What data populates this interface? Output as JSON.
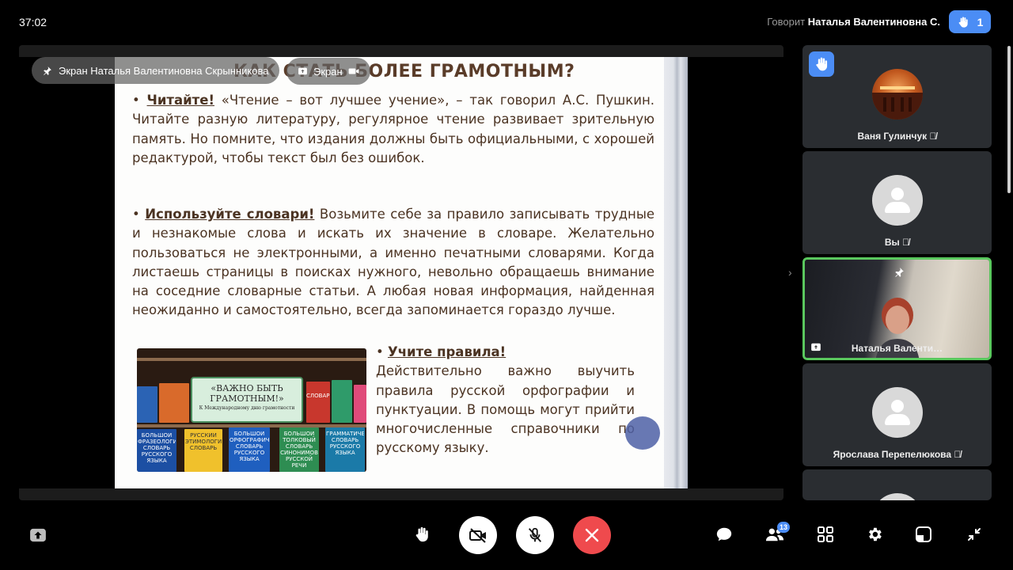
{
  "header": {
    "timer": "37:02",
    "speaking_label": "Говорит",
    "speaking_name": "Наталья Валентиновна С.",
    "raised_hands_count": "1"
  },
  "overlay": {
    "owner_chip": "Экран Наталья Валентиновна Скрынникова",
    "screen_chip": "Экран"
  },
  "slide": {
    "title": "КАК СТАТЬ БОЛЕЕ ГРАМОТНЫМ?",
    "p1_head": "Читайте!",
    "p1_body": " «Чтение – вот лучшее учение», – так говорил А.С. Пушкин. Читайте разную литературу, регулярное чтение развивает зрительную память. Но помните, что издания должны быть официальными, с хорошей редактурой, чтобы текст был без ошибок.",
    "p2_head": "Используйте словари!",
    "p2_body": " Возьмите себе за правило записывать трудные и незнакомые слова и искать их значение в словаре. Желательно пользоваться не электронными, а именно печатными словарями. Когда листаешь страницы в поисках нужного, невольно обращаешь внимание на соседние словарные статьи. А любая новая информация, найденная неожиданно и самостоятельно, всегда запоминается гораздо лучше.",
    "p3_head": "Учите правила!",
    "p3_body": "Действительно важно выучить правила русской орфографии и пунктуации. В помощь могут прийти многочисленные справочники по русскому языку.",
    "image": {
      "sign_text": "«ВАЖНО БЫТЬ ГРАМОТНЫМ!»",
      "sign_sub": "К Международному дню грамотности",
      "book1": "БОЛЬШОЙ ФРАЗЕОЛОГИЧЕСКИЙ СЛОВАРЬ РУССКОГО ЯЗЫКА",
      "book2": "РУССКИЙ ЭТИМОЛОГИЧЕСКИЙ СЛОВАРЬ",
      "book3": "БОЛЬШОЙ ОРФОГРАФИЧЕСКИЙ СЛОВАРЬ РУССКОГО ЯЗЫКА",
      "book4": "БОЛЬШОЙ ТОЛКОВЫЙ СЛОВАРЬ СИНОНИМОВ РУССКОЙ РЕЧИ",
      "book5": "ГРАММАТИЧЕСКИЙ СЛОВАРЬ РУССКОГО ЯЗЫКА",
      "top_book": "СЛОВАРЬ"
    }
  },
  "participants": [
    {
      "name": "Ваня Гулинчук",
      "muted": true,
      "hand_raised": true
    },
    {
      "name": "Вы",
      "muted": true
    },
    {
      "name": "Наталья Валенти…",
      "pinned": true,
      "sharing": true
    },
    {
      "name": "Ярослава Перепелюкова",
      "muted": true
    },
    {
      "name": ""
    }
  ],
  "toolbar": {
    "participants_count": "13"
  },
  "colors": {
    "accent": "#4b8df5",
    "end_call": "#ef4a4d",
    "active_border": "#5ac85e",
    "slide_text": "#4b3322"
  }
}
